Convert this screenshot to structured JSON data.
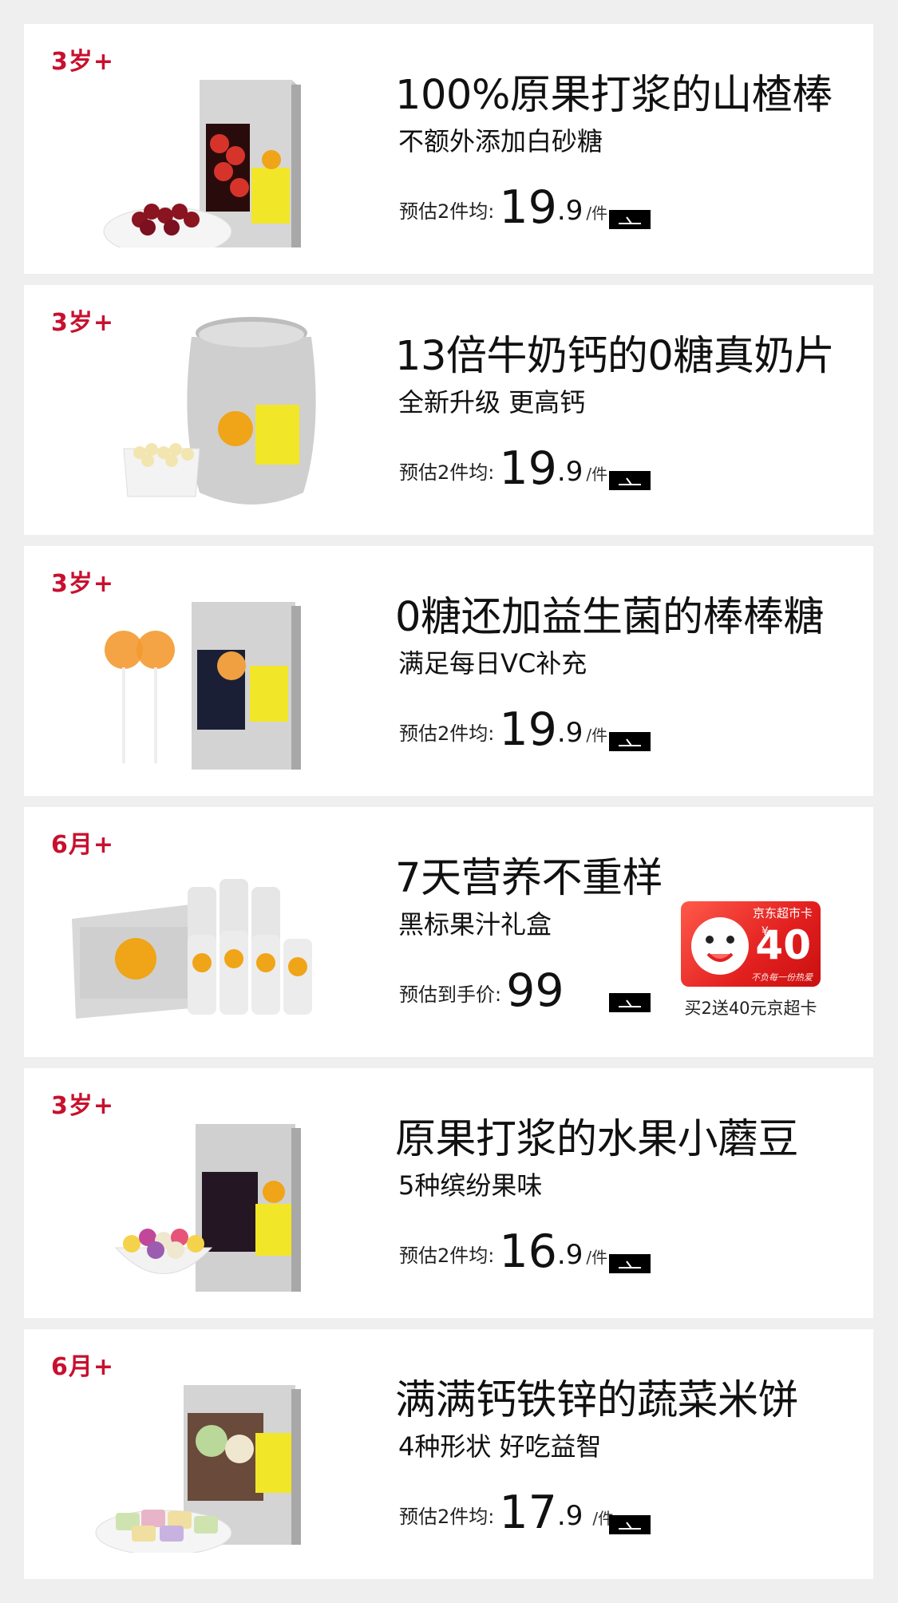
{
  "products": [
    {
      "age": "3岁+",
      "title": "100%原果打浆的山楂棒",
      "subtitle": "不额外添加白砂糖",
      "price_prefix": "预估2件均:",
      "price_int": "19",
      "price_dec": ".9",
      "unit": "/件",
      "image": "hawthorn-sticks-box-image"
    },
    {
      "age": "3岁+",
      "title": "13倍牛奶钙的0糖真奶片",
      "subtitle": "全新升级 更高钙",
      "price_prefix": "预估2件均:",
      "price_int": "19",
      "price_dec": ".9",
      "unit": "/件",
      "image": "milk-tablets-can-image"
    },
    {
      "age": "3岁+",
      "title": "0糖还加益生菌的棒棒糖",
      "subtitle": "满足每日VC补充",
      "price_prefix": "预估2件均:",
      "price_int": "19",
      "price_dec": ".9",
      "unit": "/件",
      "image": "lollipop-box-image"
    },
    {
      "age": "6月+",
      "title": "7天营养不重样",
      "subtitle": "黑标果汁礼盒",
      "price_prefix": "预估到手价:",
      "price_int": "99",
      "price_dec": "",
      "unit": "",
      "image": "juice-gift-box-image"
    },
    {
      "age": "3岁+",
      "title": "原果打浆的水果小蘑豆",
      "subtitle": "5种缤纷果味",
      "price_prefix": "预估2件均:",
      "price_int": "16",
      "price_dec": ".9",
      "unit": "/件",
      "image": "fruit-melts-box-image"
    },
    {
      "age": "6月+",
      "title": "满满钙铁锌的蔬菜米饼",
      "subtitle": "4种形状 好吃益智",
      "price_prefix": "预估2件均:",
      "price_int": "17",
      "price_dec": ".9",
      "unit": "/件",
      "image": "veggie-rice-cracker-box-image"
    }
  ],
  "gift_card": {
    "title": "京东超市卡",
    "currency": "¥",
    "amount": "40",
    "slogan": "不负每一份热爱",
    "caption": "买2送40元京超卡"
  },
  "colors": {
    "age_red": "#c8102e",
    "card_bg": "#ffffff",
    "page_bg": "#efefef",
    "gift_red": "#e21f1f"
  }
}
